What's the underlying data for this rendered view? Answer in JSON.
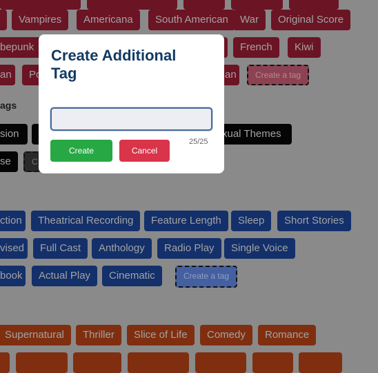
{
  "background_tags": {
    "red_row_top": [
      "",
      "",
      "",
      "",
      ""
    ],
    "red_row_1": [
      "Vampires",
      "Americana",
      "South American",
      "War",
      "Original Score"
    ],
    "red_row_2": [
      "bepunk",
      "French",
      "Kiwi"
    ],
    "red_row_3": [
      "an",
      "Po",
      "an"
    ],
    "red_create": "Create a tag",
    "content_section_label": "ags",
    "black_row_1": [
      "sion",
      "xual Themes"
    ],
    "black_row_2": [
      "se",
      "C"
    ],
    "blue_row_1": [
      "ction",
      "Theatrical Recording",
      "Feature Length",
      "Sleep",
      "Short Stories"
    ],
    "blue_row_2": [
      "vised",
      "Full Cast",
      "Anthology",
      "Radio Play",
      "Single Voice"
    ],
    "blue_row_3": [
      "book",
      "Actual Play",
      "Cinematic"
    ],
    "blue_create": "Create a tag",
    "orange_row_1": [
      "Supernatural",
      "Thriller",
      "Slice of Life",
      "Comedy",
      "Romance"
    ]
  },
  "modal": {
    "title": "Create Additional Tag",
    "input_value": "",
    "input_placeholder": "",
    "counter": "25/25",
    "create_label": "Create",
    "cancel_label": "Cancel"
  },
  "colors": {
    "tag_red": "#6b1424",
    "tag_black": "#050505",
    "tag_blue": "#13306b",
    "tag_orange": "#7f2f10",
    "create_button": "#27a845",
    "cancel_button": "#d9344a",
    "modal_title": "#123a63"
  }
}
